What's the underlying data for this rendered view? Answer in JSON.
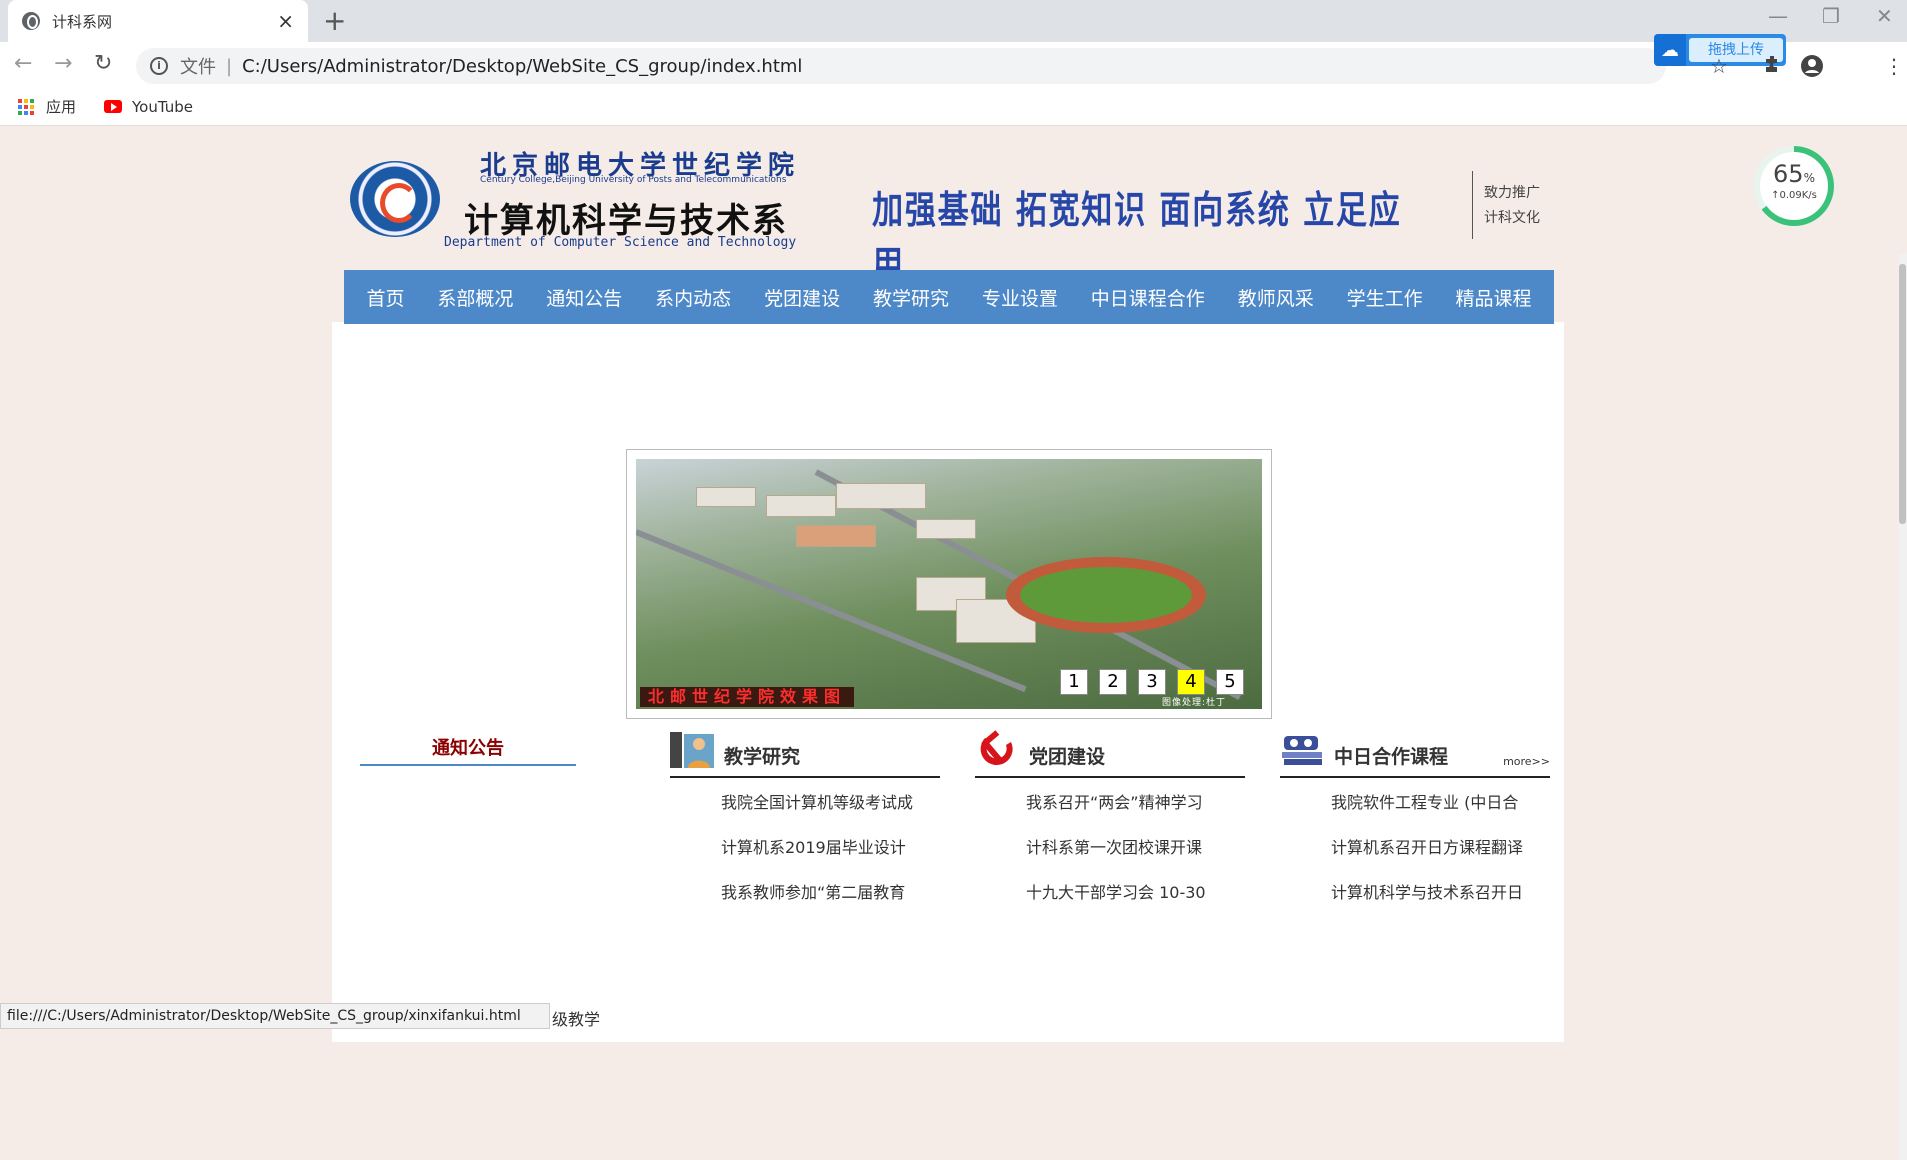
{
  "browser": {
    "tab_title": "计科系网",
    "tab_close": "×",
    "new_tab": "+",
    "scheme_label": "文件",
    "url": "C:/Users/Administrator/Desktop/WebSite_CS_group/index.html",
    "upload_label": "拖拽上传",
    "bookmarks": {
      "apps": "应用",
      "youtube": "YouTube"
    },
    "status_url": "file:///C:/Users/Administrator/Desktop/WebSite_CS_group/xinxifankui.html",
    "status_behind_text": "级教学"
  },
  "speed_widget": {
    "percent": "65",
    "percent_sign": "%",
    "rate": "↑0.09K/s",
    "progress_fraction": 0.65
  },
  "header": {
    "school_cn": "北京邮电大学世纪学院",
    "school_en": "Century College,Beijing University of Posts and Telecommunications",
    "dept_cn": "计算机科学与技术系",
    "dept_en": "Department of Computer Science and Technology",
    "slogan": "加强基础 拓宽知识 面向系统 立足应用",
    "side_links": [
      "致力推广",
      "计科文化"
    ]
  },
  "nav": [
    "首页",
    "系部概况",
    "通知公告",
    "系内动态",
    "党团建设",
    "教学研究",
    "专业设置",
    "中日课程合作",
    "教师风采",
    "学生工作",
    "精品课程"
  ],
  "slider": {
    "caption": "北邮世纪学院效果图",
    "credit": "图像处理:杜丁",
    "pages": [
      "1",
      "2",
      "3",
      "4",
      "5"
    ],
    "active_page": "4"
  },
  "notice": {
    "title": "通知公告"
  },
  "columns": [
    {
      "title": "教学研究",
      "more": "",
      "items": [
        "我院全国计算机等级考试成",
        "计算机系2019届毕业设计",
        "我系教师参加“第二届教育"
      ]
    },
    {
      "title": "党团建设",
      "more": "",
      "items": [
        "我系召开“两会”精神学习",
        "计科系第一次团校课开课",
        "十九大干部学习会 10-30"
      ]
    },
    {
      "title": "中日合作课程",
      "more": "more>>",
      "items": [
        "我院软件工程专业 (中日合",
        "计算机系召开日方课程翻译",
        "计算机科学与技术系召开日"
      ]
    }
  ],
  "colors": {
    "nav_bg": "#4d88c8",
    "active_dot": "#ffff00",
    "notice_title": "#8b0000",
    "slogan": "#2747a8"
  }
}
